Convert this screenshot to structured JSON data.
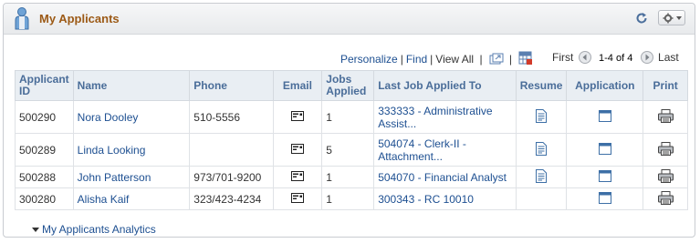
{
  "pagelet": {
    "title": "My Applicants",
    "icons": {
      "header": "person-icon",
      "refresh": "refresh-icon",
      "settings": "gear-icon"
    }
  },
  "grid_nav": {
    "personalize": "Personalize",
    "find": "Find",
    "view_all": "View All",
    "first": "First",
    "counter": "1-4 of 4",
    "last": "Last"
  },
  "table": {
    "headers": {
      "applicant_id": "Applicant ID",
      "name": "Name",
      "phone": "Phone",
      "email": "Email",
      "jobs_applied": "Jobs Applied",
      "last_job": "Last Job Applied To",
      "resume": "Resume",
      "application": "Application",
      "print": "Print"
    },
    "rows": [
      {
        "id": "500290",
        "name": "Nora Dooley",
        "phone": "510-5556",
        "jobs": "1",
        "last_job_line1": "333333 - Administrative",
        "last_job_line2": "Assist...",
        "has_resume": true
      },
      {
        "id": "500289",
        "name": "Linda Looking",
        "phone": "",
        "jobs": "5",
        "last_job_line1": "504074 - Clerk-II -",
        "last_job_line2": "Attachment...",
        "has_resume": true
      },
      {
        "id": "500288",
        "name": "John Patterson",
        "phone": "973/701-9200",
        "jobs": "1",
        "last_job_line1": "504070 - Financial Analyst",
        "last_job_line2": "",
        "has_resume": true
      },
      {
        "id": "300280",
        "name": "Alisha Kaif",
        "phone": "323/423-4234",
        "jobs": "1",
        "last_job_line1": "300343 - RC 10010",
        "last_job_line2": "",
        "has_resume": false
      }
    ]
  },
  "analytics": {
    "label": "My Applicants Analytics"
  },
  "colors": {
    "title": "#9c5a16",
    "link": "#1d4f91",
    "header_text": "#4a6d99"
  }
}
